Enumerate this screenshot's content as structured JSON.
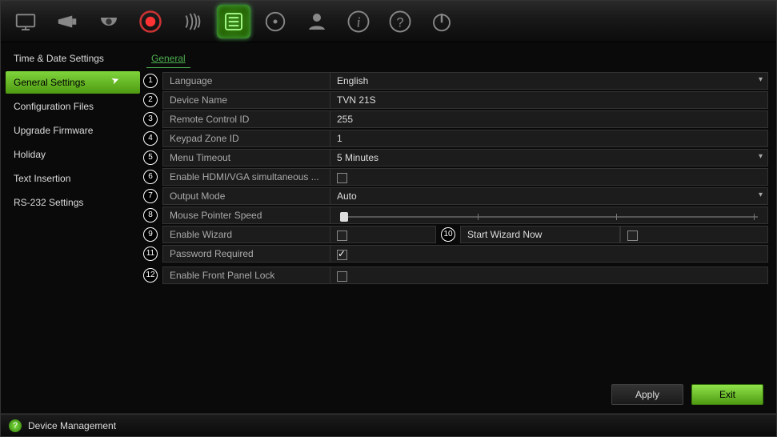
{
  "toolbar_icons": [
    "monitor",
    "camera",
    "dome",
    "record",
    "motion",
    "settings",
    "disk",
    "user",
    "info",
    "help",
    "power"
  ],
  "active_toolbar_index": 5,
  "sidebar": {
    "items": [
      {
        "label": "Time & Date Settings"
      },
      {
        "label": "General Settings"
      },
      {
        "label": "Configuration Files"
      },
      {
        "label": "Upgrade Firmware"
      },
      {
        "label": "Holiday"
      },
      {
        "label": "Text Insertion"
      },
      {
        "label": "RS-232 Settings"
      }
    ],
    "active_index": 1
  },
  "tab": {
    "label": "General"
  },
  "rows": {
    "r1": {
      "n": "1",
      "label": "Language",
      "value": "English",
      "type": "dropdown"
    },
    "r2": {
      "n": "2",
      "label": "Device Name",
      "value": "TVN 21S",
      "type": "text"
    },
    "r3": {
      "n": "3",
      "label": "Remote Control ID",
      "value": "255",
      "type": "text"
    },
    "r4": {
      "n": "4",
      "label": "Keypad Zone ID",
      "value": "1",
      "type": "text"
    },
    "r5": {
      "n": "5",
      "label": "Menu Timeout",
      "value": "5 Minutes",
      "type": "dropdown"
    },
    "r6": {
      "n": "6",
      "label": "Enable HDMI/VGA simultaneous ...",
      "checked": false,
      "type": "check"
    },
    "r7": {
      "n": "7",
      "label": "Output Mode",
      "value": "Auto",
      "type": "dropdown"
    },
    "r8": {
      "n": "8",
      "label": "Mouse Pointer Speed",
      "type": "slider",
      "position": 0
    },
    "r9": {
      "n": "9",
      "label": "Enable Wizard",
      "checked": false,
      "type": "check"
    },
    "r10": {
      "n": "10",
      "label": "Start Wizard Now",
      "checked": false,
      "type": "check-mid"
    },
    "r11": {
      "n": "11",
      "label": "Password Required",
      "checked": true,
      "type": "check"
    },
    "r12": {
      "n": "12",
      "label": "Enable Front Panel Lock",
      "checked": false,
      "type": "check"
    }
  },
  "buttons": {
    "apply": "Apply",
    "exit": "Exit"
  },
  "status": {
    "title": "Device Management"
  }
}
